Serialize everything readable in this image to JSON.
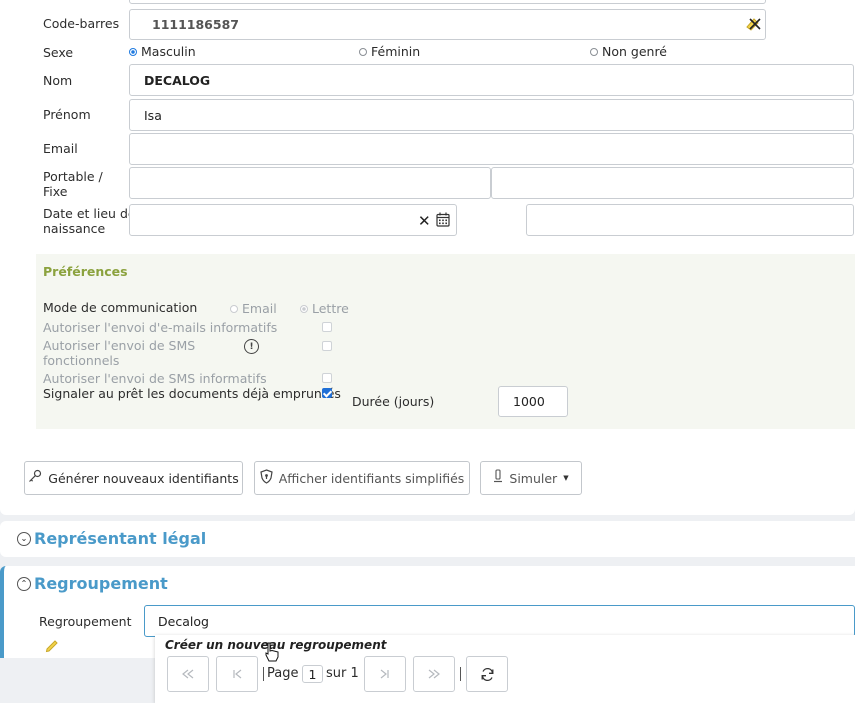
{
  "identity": {
    "barcode_label": "Code-barres",
    "barcode_value": "1111186587",
    "sex_label": "Sexe",
    "sex_options": [
      "Masculin",
      "Féminin",
      "Non genré"
    ],
    "sex_selected": "Masculin",
    "name_label": "Nom",
    "name_value": "DECALOG",
    "firstname_label": "Prénom",
    "firstname_value": "Isa",
    "email_label": "Email",
    "email_value": "",
    "phone_label_1": "Portable /",
    "phone_label_2": "Fixe",
    "birth_label_1": "Date et lieu de",
    "birth_label_2": "naissance"
  },
  "preferences": {
    "title": "Préférences",
    "comm_label": "Mode de communication",
    "comm_options": [
      "Email",
      "Lettre"
    ],
    "comm_selected": "Lettre",
    "email_info_label": "Autoriser l'envoi d'e-mails informatifs",
    "sms_func_label_1": "Autoriser l'envoi de SMS",
    "sms_func_label_2": "fonctionnels",
    "sms_info_label": "Autoriser l'envoi de SMS informatifs",
    "signal_label": "Signaler au prêt les documents déjà empruntés",
    "signal_checked": true,
    "duration_label": "Durée (jours)",
    "duration_value": "1000"
  },
  "actions": {
    "generate": "Générer nouveaux identifiants",
    "show_simplified": "Afficher identifiants simplifiés",
    "simulate": "Simuler"
  },
  "sections": {
    "legal_rep": "Représentant légal",
    "grouping": "Regroupement"
  },
  "grouping": {
    "label": "Regroupement",
    "input_value": "Decalog",
    "create_new": "Créer un nouveau regroupement"
  },
  "pager": {
    "page_label": "Page",
    "page_value": "1",
    "of_label": "sur 1"
  },
  "colors": {
    "accent_blue": "#4a9ac9",
    "pref_green": "#8ba23e",
    "checkbox_blue": "#1f6fd6"
  }
}
